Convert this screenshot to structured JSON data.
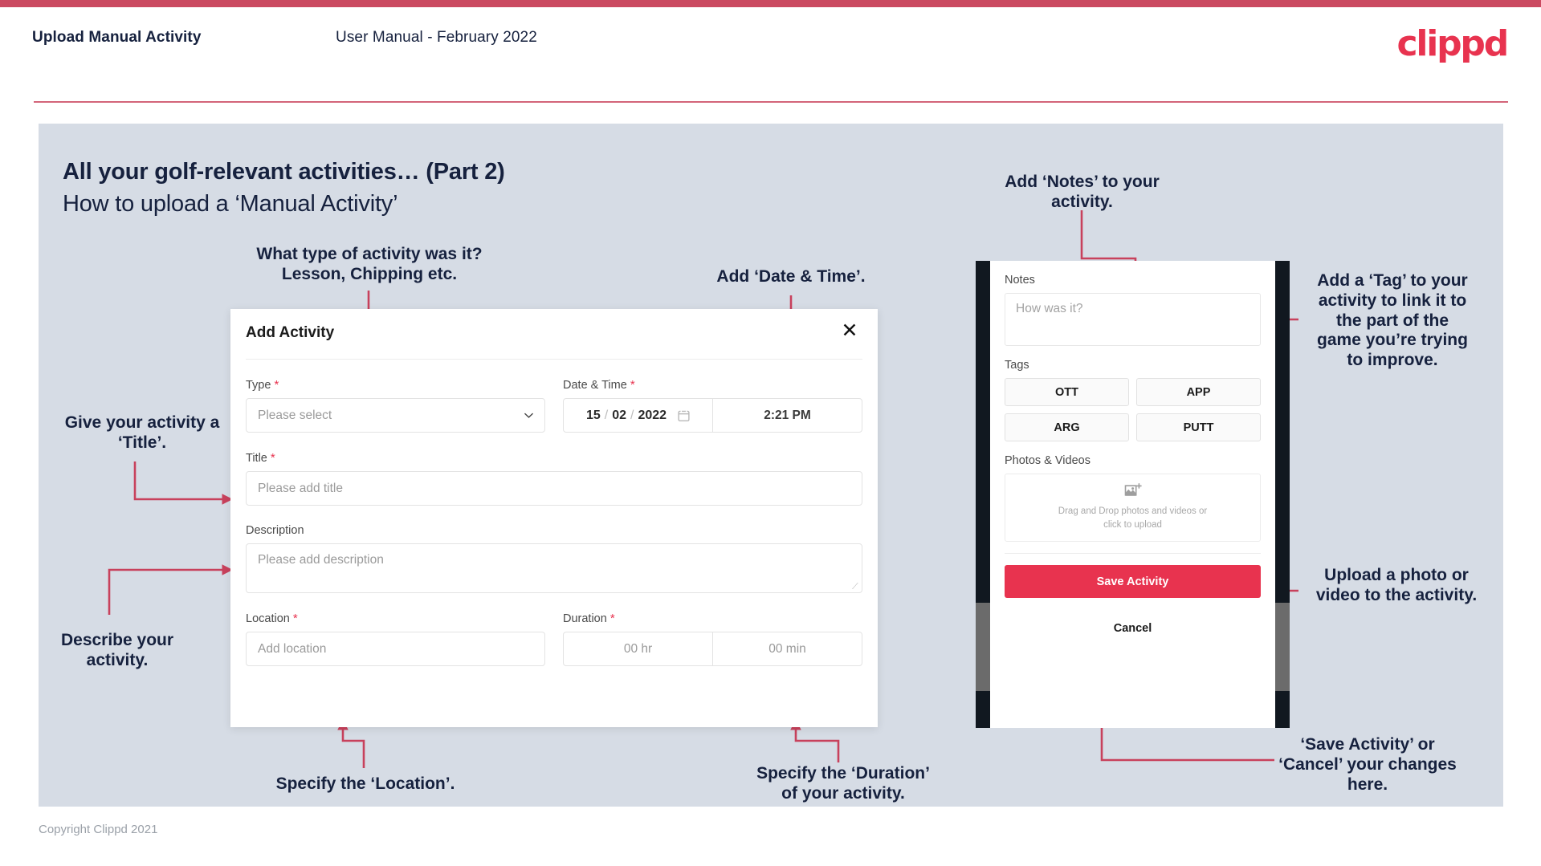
{
  "header": {
    "title": "Upload Manual Activity",
    "subtitle": "User Manual - February 2022",
    "logo": "clippd"
  },
  "slide": {
    "title": "All your golf-relevant activities… (Part 2)",
    "subtitle": "How to upload a ‘Manual Activity’"
  },
  "annotations": {
    "type": "What type of activity was it?\nLesson, Chipping etc.",
    "date_time": "Add ‘Date & Time’.",
    "title_field": "Give your activity a\n‘Title’.",
    "description": "Describe your\nactivity.",
    "location": "Specify the ‘Location’.",
    "duration": "Specify the ‘Duration’\nof your activity.",
    "notes": "Add ‘Notes’ to your\nactivity.",
    "tags": "Add a ‘Tag’ to your\nactivity to link it to\nthe part of the\ngame you’re trying\nto improve.",
    "photos": "Upload a photo or\nvideo to the activity.",
    "save_cancel": "‘Save Activity’ or\n‘Cancel’ your changes\nhere."
  },
  "dialog": {
    "title": "Add Activity",
    "close_label": "✕",
    "fields": {
      "type": {
        "label": "Type",
        "required": "*",
        "placeholder": "Please select"
      },
      "datetime": {
        "label": "Date & Time",
        "required": "*",
        "day": "15",
        "month": "02",
        "year": "2022",
        "sep": "/",
        "time": "2:21 PM"
      },
      "title": {
        "label": "Title",
        "required": "*",
        "placeholder": "Please add title"
      },
      "description": {
        "label": "Description",
        "required": "",
        "placeholder": "Please add description"
      },
      "location": {
        "label": "Location",
        "required": "*",
        "placeholder": "Add location"
      },
      "duration": {
        "label": "Duration",
        "required": "*",
        "hours_placeholder": "00 hr",
        "minutes_placeholder": "00 min"
      }
    }
  },
  "phone": {
    "notes": {
      "label": "Notes",
      "placeholder": "How was it?"
    },
    "tags": {
      "label": "Tags",
      "items": [
        "OTT",
        "APP",
        "ARG",
        "PUTT"
      ]
    },
    "photos": {
      "label": "Photos & Videos",
      "dropzone_line1": "Drag and Drop photos and videos or",
      "dropzone_line2": "click to upload"
    },
    "save_label": "Save Activity",
    "cancel_label": "Cancel"
  },
  "footer": {
    "copyright": "Copyright Clippd 2021"
  },
  "colors": {
    "accent": "#e8334f",
    "accent_bar": "#cb4a61",
    "panel_bg": "#d6dce5",
    "text_dark": "#16213e",
    "bezel_dark": "#111820",
    "bezel_gray": "#6b6b6b"
  }
}
